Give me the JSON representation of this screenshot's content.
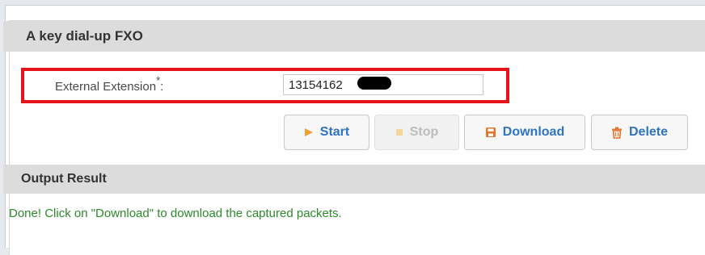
{
  "section_fxo": {
    "title": "A key dial-up FXO"
  },
  "external_extension": {
    "label": "External Extension",
    "required_mark": "*",
    "suffix": ":",
    "value": "13154162"
  },
  "buttons": {
    "start": "Start",
    "stop": "Stop",
    "download": "Download",
    "delete": "Delete"
  },
  "output": {
    "title": "Output Result",
    "message": "Done! Click on \"Download\" to download the captured packets."
  },
  "colors": {
    "highlight": "#e5141a",
    "button_text": "#2f74c0",
    "success_text": "#2c8a2c",
    "header_bg": "#dcdcdc"
  },
  "icons": {
    "start": "play-triangle-icon",
    "stop": "stop-square-icon",
    "download": "save-disk-icon",
    "delete": "trash-can-icon"
  }
}
